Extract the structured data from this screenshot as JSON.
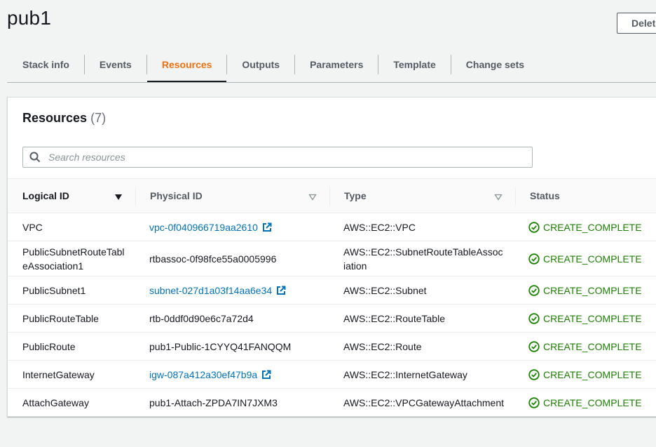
{
  "stack": {
    "title": "pub1",
    "delete_label": "Delete"
  },
  "tabs": [
    {
      "label": "Stack info",
      "active": false
    },
    {
      "label": "Events",
      "active": false
    },
    {
      "label": "Resources",
      "active": true
    },
    {
      "label": "Outputs",
      "active": false
    },
    {
      "label": "Parameters",
      "active": false
    },
    {
      "label": "Template",
      "active": false
    },
    {
      "label": "Change sets",
      "active": false
    }
  ],
  "resources": {
    "title": "Resources",
    "count": "(7)",
    "search_placeholder": "Search resources",
    "search_value": "",
    "columns": [
      "Logical ID",
      "Physical ID",
      "Type",
      "Status"
    ],
    "rows": [
      {
        "logical_id": "VPC",
        "physical_id": "vpc-0f040966719aa2610",
        "physical_link": true,
        "type": "AWS::EC2::VPC",
        "status": "CREATE_COMPLETE"
      },
      {
        "logical_id": "PublicSubnetRouteTableAssociation1",
        "physical_id": "rtbassoc-0f98fce55a0005996",
        "physical_link": false,
        "type": "AWS::EC2::SubnetRouteTableAssociation",
        "status": "CREATE_COMPLETE"
      },
      {
        "logical_id": "PublicSubnet1",
        "physical_id": "subnet-027d1a03f14aa6e34",
        "physical_link": true,
        "type": "AWS::EC2::Subnet",
        "status": "CREATE_COMPLETE"
      },
      {
        "logical_id": "PublicRouteTable",
        "physical_id": "rtb-0ddf0d90e6c7a72d4",
        "physical_link": false,
        "type": "AWS::EC2::RouteTable",
        "status": "CREATE_COMPLETE"
      },
      {
        "logical_id": "PublicRoute",
        "physical_id": "pub1-Public-1CYYQ41FANQQM",
        "physical_link": false,
        "type": "AWS::EC2::Route",
        "status": "CREATE_COMPLETE"
      },
      {
        "logical_id": "InternetGateway",
        "physical_id": "igw-087a412a30ef47b9a",
        "physical_link": true,
        "type": "AWS::EC2::InternetGateway",
        "status": "CREATE_COMPLETE"
      },
      {
        "logical_id": "AttachGateway",
        "physical_id": "pub1-Attach-ZPDA7IN7JXM3",
        "physical_link": false,
        "type": "AWS::EC2::VPCGatewayAttachment",
        "status": "CREATE_COMPLETE"
      }
    ]
  },
  "colors": {
    "accent": "#ec7211",
    "link": "#0073bb",
    "success": "#1d8102"
  },
  "icons": {
    "search": "search-icon",
    "external": "external-link-icon",
    "status_ok": "check-circle-icon",
    "sort_desc": "caret-down-icon",
    "sort": "caret-down-outline-icon"
  }
}
